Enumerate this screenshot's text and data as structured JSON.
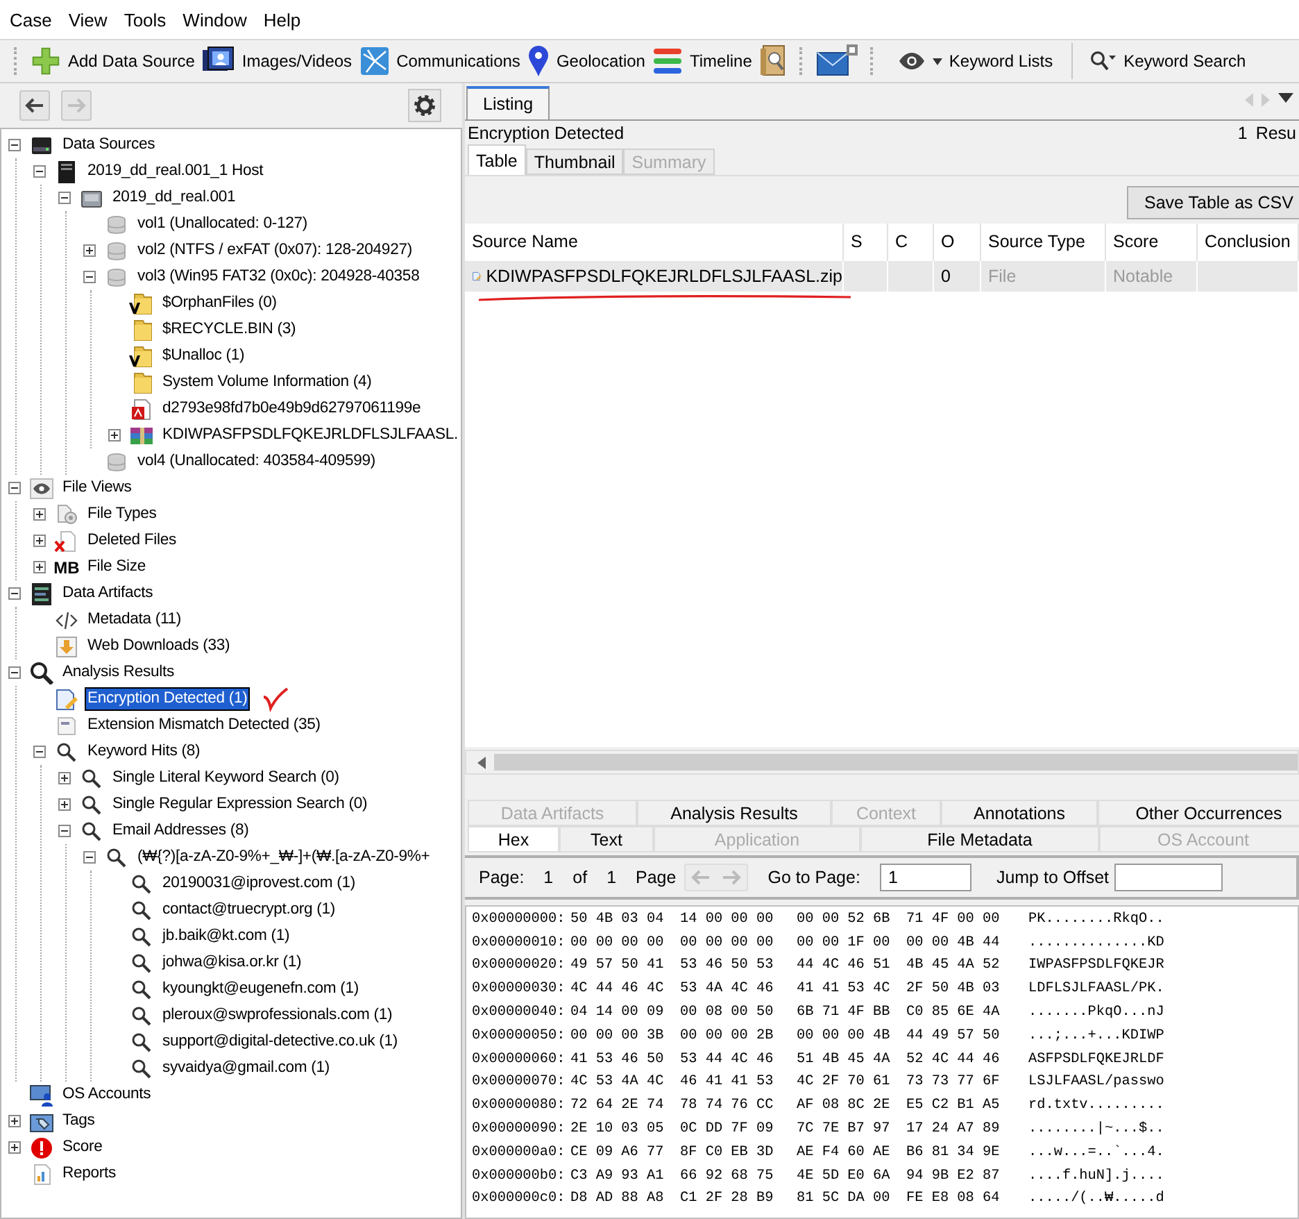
{
  "menu": [
    "Case",
    "View",
    "Tools",
    "Window",
    "Help"
  ],
  "toolbar": [
    {
      "kind": "add",
      "label": "Add Data Source"
    },
    {
      "kind": "images",
      "label": "Images/Videos"
    },
    {
      "kind": "communications",
      "label": "Communications"
    },
    {
      "kind": "geolocation",
      "label": "Geolocation"
    },
    {
      "kind": "timeline",
      "label": "Timeline"
    },
    {
      "kind": "book"
    },
    {
      "kind": "mail"
    },
    {
      "kind": "keyword-lists",
      "label": "Keyword Lists"
    },
    {
      "kind": "keyword-search",
      "label": "Keyword Search"
    }
  ],
  "nav": {
    "back": {
      "disabled": false
    },
    "forward": {
      "disabled": true
    }
  },
  "tree": [
    {
      "label": "Data Sources",
      "kind": "sources",
      "expanded": true,
      "selected": false,
      "children": [
        {
          "label": "2019_dd_real.001_1 Host",
          "kind": "host",
          "expanded": true,
          "selected": false,
          "children": [
            {
              "label": "2019_dd_real.001",
              "kind": "image",
              "expanded": true,
              "selected": false,
              "children": [
                {
                  "label": "vol1 (Unallocated: 0-127)",
                  "kind": "volume",
                  "selected": false
                },
                {
                  "label": "vol2 (NTFS / exFAT (0x07): 128-204927)",
                  "kind": "volume",
                  "expanded": false,
                  "selected": false
                },
                {
                  "label": "vol3 (Win95 FAT32 (0x0c): 204928-40358",
                  "kind": "volume",
                  "expanded": true,
                  "selected": false,
                  "children": [
                    {
                      "label": "$OrphanFiles (0)",
                      "kind": "virtual-folder",
                      "selected": false
                    },
                    {
                      "label": "$RECYCLE.BIN (3)",
                      "kind": "folder",
                      "selected": false
                    },
                    {
                      "label": "$Unalloc (1)",
                      "kind": "virtual-folder",
                      "selected": false
                    },
                    {
                      "label": "System Volume Information (4)",
                      "kind": "folder",
                      "selected": false
                    },
                    {
                      "label": "d2793e98fd7b0e49b9d62797061199e",
                      "kind": "pdf",
                      "selected": false
                    },
                    {
                      "label": "KDIWPASFPSDLFQKEJRLDFLSJLFAASL.",
                      "kind": "archive",
                      "expanded": false,
                      "selected": false
                    }
                  ]
                },
                {
                  "label": "vol4 (Unallocated: 403584-409599)",
                  "kind": "volume",
                  "selected": false
                }
              ]
            }
          ]
        }
      ]
    },
    {
      "label": "File Views",
      "kind": "views",
      "expanded": true,
      "selected": false,
      "children": [
        {
          "label": "File Types",
          "kind": "file-types",
          "expanded": false,
          "selected": false
        },
        {
          "label": "Deleted Files",
          "kind": "deleted",
          "expanded": false,
          "selected": false
        },
        {
          "label": "File Size",
          "kind": "size",
          "icon_text": "MB",
          "expanded": false,
          "selected": false
        }
      ]
    },
    {
      "label": "Data Artifacts",
      "kind": "artifacts",
      "expanded": true,
      "selected": false,
      "children": [
        {
          "label": "Metadata (11)",
          "kind": "metadata",
          "selected": false
        },
        {
          "label": "Web Downloads (33)",
          "kind": "download",
          "selected": false
        }
      ]
    },
    {
      "label": "Analysis Results",
      "kind": "analysis",
      "expanded": true,
      "selected": false,
      "children": [
        {
          "label": "Encryption Detected (1)",
          "kind": "encrypted",
          "selected": true
        },
        {
          "label": "Extension Mismatch Detected (35)",
          "kind": "mismatch",
          "selected": false
        },
        {
          "label": "Keyword Hits (8)",
          "kind": "keyword",
          "expanded": true,
          "selected": false,
          "children": [
            {
              "label": "Single Literal Keyword Search (0)",
              "kind": "keyword",
              "expanded": false,
              "selected": false
            },
            {
              "label": "Single Regular Expression Search (0)",
              "kind": "keyword",
              "expanded": false,
              "selected": false
            },
            {
              "label": "Email Addresses (8)",
              "kind": "keyword",
              "expanded": true,
              "selected": false,
              "children": [
                {
                  "label": "(₩{?)[a-zA-Z0-9%+_₩-]+(₩.[a-zA-Z0-9%+",
                  "kind": "keyword",
                  "expanded": true,
                  "selected": false,
                  "children": [
                    {
                      "label": "20190031@iprovest.com (1)",
                      "kind": "keyword",
                      "selected": false
                    },
                    {
                      "label": "contact@truecrypt.org (1)",
                      "kind": "keyword",
                      "selected": false
                    },
                    {
                      "label": "jb.baik@kt.com (1)",
                      "kind": "keyword",
                      "selected": false
                    },
                    {
                      "label": "johwa@kisa.or.kr (1)",
                      "kind": "keyword",
                      "selected": false
                    },
                    {
                      "label": "kyoungkt@eugenefn.com (1)",
                      "kind": "keyword",
                      "selected": false
                    },
                    {
                      "label": "pleroux@swprofessionals.com (1)",
                      "kind": "keyword",
                      "selected": false
                    },
                    {
                      "label": "support@digital-detective.co.uk (1)",
                      "kind": "keyword",
                      "selected": false
                    },
                    {
                      "label": "syvaidya@gmail.com (1)",
                      "kind": "keyword",
                      "selected": false
                    }
                  ]
                }
              ]
            }
          ]
        }
      ]
    },
    {
      "label": "OS Accounts",
      "kind": "accounts",
      "selected": false
    },
    {
      "label": "Tags",
      "kind": "tags",
      "expanded": false,
      "selected": false
    },
    {
      "label": "Score",
      "kind": "score",
      "expanded": false,
      "selected": false
    },
    {
      "label": "Reports",
      "kind": "reports",
      "selected": false
    }
  ],
  "listing": {
    "tabs": [
      {
        "label": "Listing",
        "selected": true
      }
    ],
    "title": "Encryption Detected",
    "result_count": "1",
    "result_label": "Resu",
    "view_tabs": [
      {
        "label": "Table",
        "selected": true,
        "disabled": false
      },
      {
        "label": "Thumbnail",
        "selected": false,
        "disabled": false
      },
      {
        "label": "Summary",
        "selected": false,
        "disabled": true
      }
    ],
    "save_button": "Save Table as CSV",
    "columns": [
      "Source Name",
      "S",
      "C",
      "O",
      "Source Type",
      "Score",
      "Conclusion"
    ],
    "rows": [
      {
        "selected": true,
        "cells": [
          "KDIWPASFPSDLFQKEJRLDFLSJLFAASL.zip",
          null,
          null,
          "0",
          "File",
          "Notable",
          null
        ]
      }
    ]
  },
  "viewer": {
    "upper_tabs": [
      {
        "label": "Data Artifacts",
        "disabled": true
      },
      {
        "label": "Analysis Results",
        "disabled": false
      },
      {
        "label": "Context",
        "disabled": true
      },
      {
        "label": "Annotations",
        "disabled": false
      },
      {
        "label": "Other Occurrences",
        "disabled": false
      }
    ],
    "lower_tabs": [
      {
        "label": "Hex",
        "selected": true,
        "disabled": false
      },
      {
        "label": "Text",
        "selected": false,
        "disabled": false
      },
      {
        "label": "Application",
        "selected": false,
        "disabled": true
      },
      {
        "label": "File Metadata",
        "selected": false,
        "disabled": false
      },
      {
        "label": "OS Account",
        "selected": false,
        "disabled": true
      }
    ],
    "page_label": "Page:",
    "page": "1",
    "of_label": "of",
    "page_total": "1",
    "page_nav_label": "Page",
    "goto_label": "Go to Page:",
    "goto_value": "1",
    "offset_label": "Jump to Offset",
    "hex_rows": [
      {
        "offset": "0x00000000:",
        "bytes": [
          "50 4B 03 04",
          "14 00 00 00",
          "00 00 52 6B",
          "71 4F 00 00"
        ],
        "ascii": "PK........RkqO.."
      },
      {
        "offset": "0x00000010:",
        "bytes": [
          "00 00 00 00",
          "00 00 00 00",
          "00 00 1F 00",
          "00 00 4B 44"
        ],
        "ascii": "..............KD"
      },
      {
        "offset": "0x00000020:",
        "bytes": [
          "49 57 50 41",
          "53 46 50 53",
          "44 4C 46 51",
          "4B 45 4A 52"
        ],
        "ascii": "IWPASFPSDLFQKEJR"
      },
      {
        "offset": "0x00000030:",
        "bytes": [
          "4C 44 46 4C",
          "53 4A 4C 46",
          "41 41 53 4C",
          "2F 50 4B 03"
        ],
        "ascii": "LDFLSJLFAASL/PK."
      },
      {
        "offset": "0x00000040:",
        "bytes": [
          "04 14 00 09",
          "00 08 00 50",
          "6B 71 4F BB",
          "C0 85 6E 4A"
        ],
        "ascii": ".......PkqO...nJ"
      },
      {
        "offset": "0x00000050:",
        "bytes": [
          "00 00 00 3B",
          "00 00 00 2B",
          "00 00 00 4B",
          "44 49 57 50"
        ],
        "ascii": "...;...+...KDIWP"
      },
      {
        "offset": "0x00000060:",
        "bytes": [
          "41 53 46 50",
          "53 44 4C 46",
          "51 4B 45 4A",
          "52 4C 44 46"
        ],
        "ascii": "ASFPSDLFQKEJRLDF"
      },
      {
        "offset": "0x00000070:",
        "bytes": [
          "4C 53 4A 4C",
          "46 41 41 53",
          "4C 2F 70 61",
          "73 73 77 6F"
        ],
        "ascii": "LSJLFAASL/passwo"
      },
      {
        "offset": "0x00000080:",
        "bytes": [
          "72 64 2E 74",
          "78 74 76 CC",
          "AF 08 8C 2E",
          "E5 C2 B1 A5"
        ],
        "ascii": "rd.txtv........."
      },
      {
        "offset": "0x00000090:",
        "bytes": [
          "2E 10 03 05",
          "0C DD 7F 09",
          "7C 7E B7 97",
          "17 24 A7 89"
        ],
        "ascii": "........|~...$.."
      },
      {
        "offset": "0x000000a0:",
        "bytes": [
          "CE 09 A6 77",
          "8F C0 EB 3D",
          "AE F4 60 AE",
          "B6 81 34 9E"
        ],
        "ascii": "...w...=..`...4."
      },
      {
        "offset": "0x000000b0:",
        "bytes": [
          "C3 A9 93 A1",
          "66 92 68 75",
          "4E 5D E0 6A",
          "94 9B E2 87"
        ],
        "ascii": "....f.huN].j...."
      },
      {
        "offset": "0x000000c0:",
        "bytes": [
          "D8 AD 88 A8",
          "C1 2F 28 B9",
          "81 5C DA 00",
          "FE E8 08 64"
        ],
        "ascii": "...../(..₩.....d"
      }
    ]
  }
}
